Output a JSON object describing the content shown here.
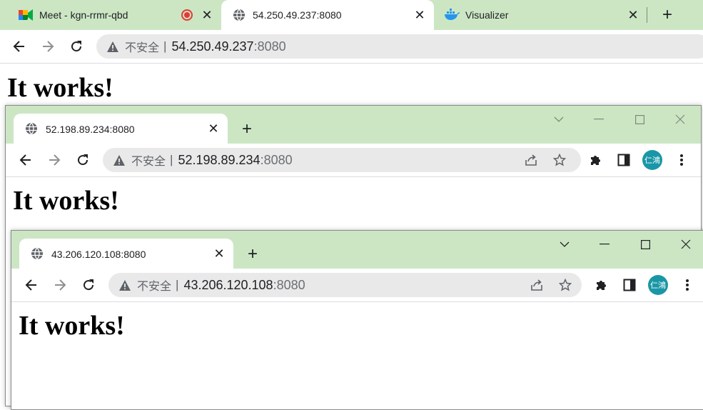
{
  "back": {
    "tabs": [
      {
        "title": "Meet - kgn-rrmr-qbd",
        "icon": "google-meet-icon",
        "indicator": "recording-indicator-icon"
      },
      {
        "title": "54.250.49.237:8080",
        "icon": "globe-icon"
      },
      {
        "title": "Visualizer",
        "icon": "docker-whale-icon"
      }
    ],
    "insecure_label": "不安全",
    "separator": "|",
    "url_host": "54.250.49.237",
    "url_port": ":8080",
    "heading": "It works!"
  },
  "window2": {
    "tab_title": "52.198.89.234:8080",
    "insecure_label": "不安全",
    "separator": "|",
    "url_host": "52.198.89.234",
    "url_port": ":8080",
    "avatar_text": "仁鴻",
    "heading": "It works!"
  },
  "window3": {
    "tab_title": "43.206.120.108:8080",
    "insecure_label": "不安全",
    "separator": "|",
    "url_host": "43.206.120.108",
    "url_port": ":8080",
    "avatar_text": "仁鴻",
    "heading": "It works!"
  },
  "colors": {
    "tabstrip": "#cce6c4",
    "omnibox": "#e9e9ea",
    "avatar": "#1a97a6",
    "recording": "#e53935"
  }
}
